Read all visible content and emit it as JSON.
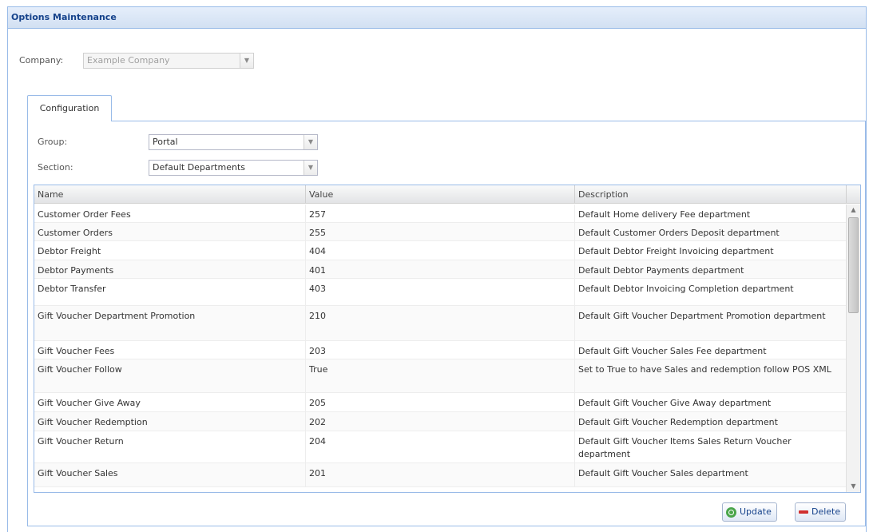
{
  "window": {
    "title": "Options Maintenance"
  },
  "company": {
    "label": "Company:",
    "value": "Example Company"
  },
  "tab": {
    "label": "Configuration"
  },
  "filters": {
    "group_label": "Group:",
    "group_value": "Portal",
    "section_label": "Section:",
    "section_value": "Default Departments"
  },
  "grid": {
    "columns": [
      "Name",
      "Value",
      "Description"
    ],
    "rows": [
      {
        "name": "Customer Order Fees",
        "value": "257",
        "description": "Default Home delivery Fee department"
      },
      {
        "name": "Customer Orders",
        "value": "255",
        "description": "Default Customer Orders Deposit department"
      },
      {
        "name": "Debtor Freight",
        "value": "404",
        "description": "Default Debtor Freight Invoicing department"
      },
      {
        "name": "Debtor Payments",
        "value": "401",
        "description": "Default Debtor Payments department"
      },
      {
        "name": "Debtor Transfer",
        "value": "403",
        "description": "Default Debtor Invoicing Completion department"
      },
      {
        "name": "Gift Voucher Department Promotion",
        "value": "210",
        "description": "Default Gift Voucher Department Promotion department"
      },
      {
        "name": "Gift Voucher Fees",
        "value": "203",
        "description": "Default Gift Voucher Sales Fee department"
      },
      {
        "name": "Gift Voucher Follow",
        "value": "True",
        "description": "Set to True to have Sales and redemption follow POS XML"
      },
      {
        "name": "Gift Voucher Give Away",
        "value": "205",
        "description": "Default Gift Voucher Give Away department"
      },
      {
        "name": "Gift Voucher Redemption",
        "value": "202",
        "description": "Default Gift Voucher Redemption department"
      },
      {
        "name": "Gift Voucher Return",
        "value": "204",
        "description": "Default Gift Voucher Items Sales Return Voucher department"
      },
      {
        "name": "Gift Voucher Sales",
        "value": "201",
        "description": "Default Gift Voucher Sales department"
      }
    ]
  },
  "buttons": {
    "update": "Update",
    "delete": "Delete"
  },
  "colors": {
    "border": "#99bbe8",
    "title_text": "#15428b",
    "update_icon": "#4aa54a",
    "delete_icon": "#d0302f"
  },
  "icons": {
    "update": "refresh-icon",
    "delete": "minus-icon",
    "dropdown": "chevron-down-icon"
  }
}
